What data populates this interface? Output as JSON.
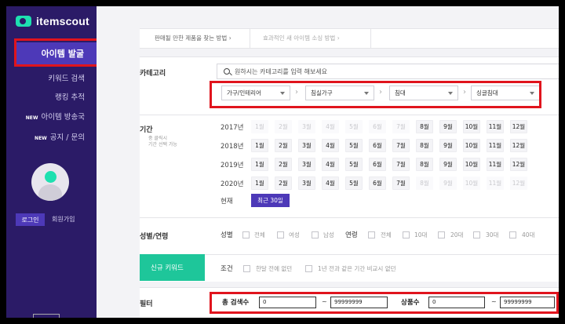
{
  "sidebar": {
    "logo": "itemscout",
    "active_item": "아이템 발굴",
    "items": [
      {
        "label": "키워드 검색",
        "new": ""
      },
      {
        "label": "랭킹 추적",
        "new": ""
      },
      {
        "label": "아이템 방송국",
        "new": "NEW"
      },
      {
        "label": "공지 / 문의",
        "new": "NEW"
      }
    ],
    "login": "로그인",
    "signup": "회원가입"
  },
  "tabs": [
    "판매될 만한 제품을 찾는 방법",
    "효과적인 새 아이템 소싱 방법"
  ],
  "category": {
    "label": "카테고리",
    "search_placeholder": "원하시는 카테고리를 입력 해보세요",
    "selects": [
      "가구/인테리어",
      "침실가구",
      "침대",
      "싱글침대"
    ]
  },
  "period": {
    "label": "기간",
    "note_line1": "중 클릭시",
    "note_line2": "기간 선택 가능",
    "years": [
      {
        "year": "2017년",
        "months": [
          "1월",
          "2월",
          "3월",
          "4월",
          "5월",
          "6월",
          "7월",
          "8월",
          "9월",
          "10월",
          "11월",
          "12월"
        ],
        "enabled_from": 8
      },
      {
        "year": "2018년",
        "months": [
          "1월",
          "2월",
          "3월",
          "4월",
          "5월",
          "6월",
          "7월",
          "8월",
          "9월",
          "10월",
          "11월",
          "12월"
        ],
        "enabled_from": 1
      },
      {
        "year": "2019년",
        "months": [
          "1월",
          "2월",
          "3월",
          "4월",
          "5월",
          "6월",
          "7월",
          "8월",
          "9월",
          "10월",
          "11월",
          "12월"
        ],
        "enabled_from": 1
      },
      {
        "year": "2020년",
        "months": [
          "1월",
          "2월",
          "3월",
          "4월",
          "5월",
          "6월",
          "7월",
          "8월",
          "9월",
          "10월",
          "11월",
          "12월"
        ],
        "enabled_from": 1,
        "enabled_to": 7
      }
    ],
    "current_label": "현재",
    "recent_button": "최근 30일"
  },
  "gender_age": {
    "label": "성별/연령",
    "gender_title": "성별",
    "genders": [
      "전체",
      "여성",
      "남성"
    ],
    "age_title": "연령",
    "ages": [
      "전체",
      "10대",
      "20대",
      "30대",
      "40대"
    ]
  },
  "new_keyword": {
    "label": "신규 키워드",
    "cond_title": "조건",
    "options": [
      "한달 전에 없던",
      "1년 전과 같은 기간 비교시 없던"
    ]
  },
  "filter": {
    "label": "필터",
    "total_search_label": "총 검색수",
    "total_min": "0",
    "total_max": "99999999",
    "products_label": "상품수",
    "products_min": "0",
    "products_max": "99999999",
    "tilde": "~"
  },
  "colors": {
    "sidebar_bg": "#2b1b67",
    "accent": "#4d39b8",
    "green": "#1ec69a",
    "highlight": "#e0141d"
  }
}
